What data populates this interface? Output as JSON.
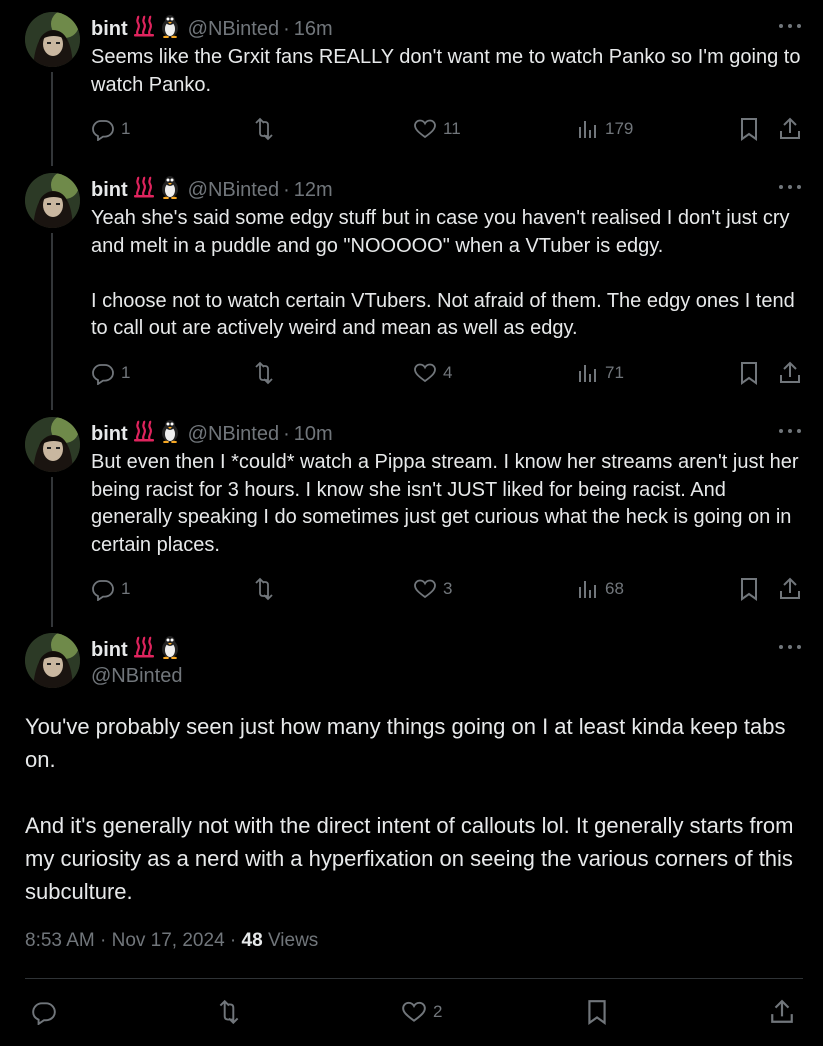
{
  "user": {
    "name": "bint",
    "handle": "@NBinted",
    "emoji_1": "hot-springs-icon",
    "emoji_2": "penguin-icon"
  },
  "thread": [
    {
      "time": "16m",
      "text": "Seems like the Grxit fans REALLY don't want me to watch Panko so I'm going to watch Panko.",
      "replies": "1",
      "retweets": "",
      "likes": "11",
      "views": "179"
    },
    {
      "time": "12m",
      "text": "Yeah she's said some edgy stuff but in case you haven't realised I don't just cry and melt in a puddle and go \"NOOOOO\" when a VTuber is edgy.\n\nI choose not to watch certain VTubers. Not afraid of them. The edgy ones I tend to call out are actively weird and mean as well as edgy.",
      "replies": "1",
      "retweets": "",
      "likes": "4",
      "views": "71"
    },
    {
      "time": "10m",
      "text": "But even then I *could* watch a Pippa stream. I know her streams aren't just her being racist for 3 hours. I know she isn't JUST liked for being racist. And generally speaking I do sometimes just get curious what the heck is going on in certain places.",
      "replies": "1",
      "retweets": "",
      "likes": "3",
      "views": "68"
    }
  ],
  "main": {
    "text": "You've probably seen just how many things going on I at least kinda keep tabs on.\n\nAnd it's generally not with the direct intent of callouts lol. It generally starts from my curiosity as a nerd with a hyperfixation on seeing the various corners of this subculture.",
    "time": "8:53 AM",
    "date": "Nov 17, 2024",
    "views_count": "48",
    "views_label": "Views",
    "likes": "2"
  },
  "colors": {
    "background": "#000000",
    "text": "#e7e9ea",
    "muted": "#71767b",
    "divider": "#2f3336"
  }
}
